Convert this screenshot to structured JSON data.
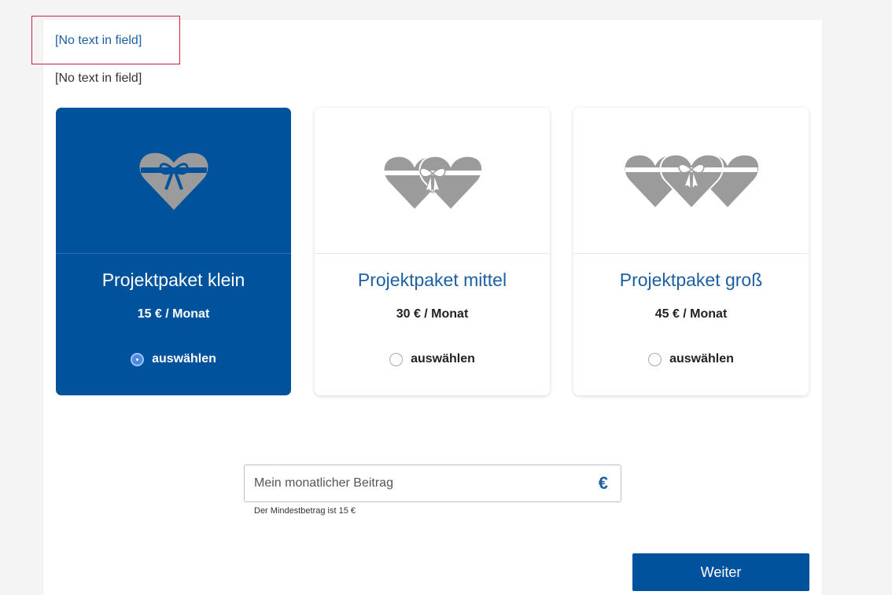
{
  "fields": {
    "first": "[No text in field]",
    "second": "[No text in field]"
  },
  "packages": [
    {
      "title": "Projektpaket klein",
      "price": "15 € / Monat",
      "choose_label": "auswählen",
      "selected": true
    },
    {
      "title": "Projektpaket mittel",
      "price": "30 € / Monat",
      "choose_label": "auswählen",
      "selected": false
    },
    {
      "title": "Projektpaket groß",
      "price": "45 € / Monat",
      "choose_label": "auswählen",
      "selected": false
    }
  ],
  "amount": {
    "placeholder": "Mein monatlicher Beitrag",
    "value": "",
    "currency_symbol": "€",
    "hint": "Der Mindestbetrag ist 15 €"
  },
  "buttons": {
    "next_label": "Weiter"
  },
  "colors": {
    "brand_blue": "#00529c",
    "link_blue": "#1d5fa3",
    "heart_gray": "#9b9b9b",
    "focus_red": "#d0223c"
  },
  "icons": {
    "package_small": "single-heart-gift-icon",
    "package_medium": "double-heart-gift-icon",
    "package_large": "triple-heart-gift-icon"
  }
}
